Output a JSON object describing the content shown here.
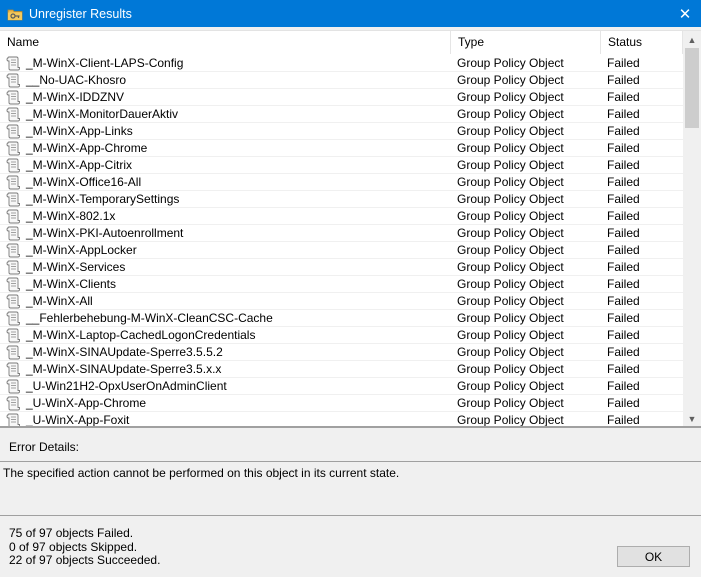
{
  "window": {
    "title": "Unregister Results",
    "title_icon": "folder-key-icon",
    "close_glyph": "✕"
  },
  "columns": {
    "name": "Name",
    "type": "Type",
    "status": "Status"
  },
  "rows": [
    {
      "name": "_M-WinX-Client-LAPS-Config",
      "type": "Group Policy Object",
      "status": "Failed"
    },
    {
      "name": "__No-UAC-Khosro",
      "type": "Group Policy Object",
      "status": "Failed"
    },
    {
      "name": "_M-WinX-IDDZNV",
      "type": "Group Policy Object",
      "status": "Failed"
    },
    {
      "name": "_M-WinX-MonitorDauerAktiv",
      "type": "Group Policy Object",
      "status": "Failed"
    },
    {
      "name": "_M-WinX-App-Links",
      "type": "Group Policy Object",
      "status": "Failed"
    },
    {
      "name": "_M-WinX-App-Chrome",
      "type": "Group Policy Object",
      "status": "Failed"
    },
    {
      "name": "_M-WinX-App-Citrix",
      "type": "Group Policy Object",
      "status": "Failed"
    },
    {
      "name": "_M-WinX-Office16-All",
      "type": "Group Policy Object",
      "status": "Failed"
    },
    {
      "name": "_M-WinX-TemporarySettings",
      "type": "Group Policy Object",
      "status": "Failed"
    },
    {
      "name": "_M-WinX-802.1x",
      "type": "Group Policy Object",
      "status": "Failed"
    },
    {
      "name": "_M-WinX-PKI-Autoenrollment",
      "type": "Group Policy Object",
      "status": "Failed"
    },
    {
      "name": "_M-WinX-AppLocker",
      "type": "Group Policy Object",
      "status": "Failed"
    },
    {
      "name": "_M-WinX-Services",
      "type": "Group Policy Object",
      "status": "Failed"
    },
    {
      "name": "_M-WinX-Clients",
      "type": "Group Policy Object",
      "status": "Failed"
    },
    {
      "name": "_M-WinX-All",
      "type": "Group Policy Object",
      "status": "Failed"
    },
    {
      "name": "__Fehlerbehebung-M-WinX-CleanCSC-Cache",
      "type": "Group Policy Object",
      "status": "Failed"
    },
    {
      "name": "_M-WinX-Laptop-CachedLogonCredentials",
      "type": "Group Policy Object",
      "status": "Failed"
    },
    {
      "name": "_M-WinX-SINAUpdate-Sperre3.5.5.2",
      "type": "Group Policy Object",
      "status": "Failed"
    },
    {
      "name": "_M-WinX-SINAUpdate-Sperre3.5.x.x",
      "type": "Group Policy Object",
      "status": "Failed"
    },
    {
      "name": "_U-Win21H2-OpxUserOnAdminClient",
      "type": "Group Policy Object",
      "status": "Failed"
    },
    {
      "name": "_U-WinX-App-Chrome",
      "type": "Group Policy Object",
      "status": "Failed"
    },
    {
      "name": "_U-WinX-App-Foxit",
      "type": "Group Policy Object",
      "status": "Failed"
    }
  ],
  "row_icon": "gpo-scroll-icon",
  "error": {
    "label": "Error Details:",
    "message": "The specified action cannot be performed on this object in its current state."
  },
  "summary": {
    "failed": "75 of 97 objects Failed.",
    "skipped": "0 of 97 objects Skipped.",
    "succeeded": "22 of 97 objects Succeeded."
  },
  "buttons": {
    "ok": "OK"
  },
  "scroll": {
    "position_fraction": 0.0,
    "visible_fraction": 0.22
  },
  "colors": {
    "titlebar": "#0078d7",
    "window_bg": "#f0f0f0",
    "list_bg": "#ffffff"
  }
}
